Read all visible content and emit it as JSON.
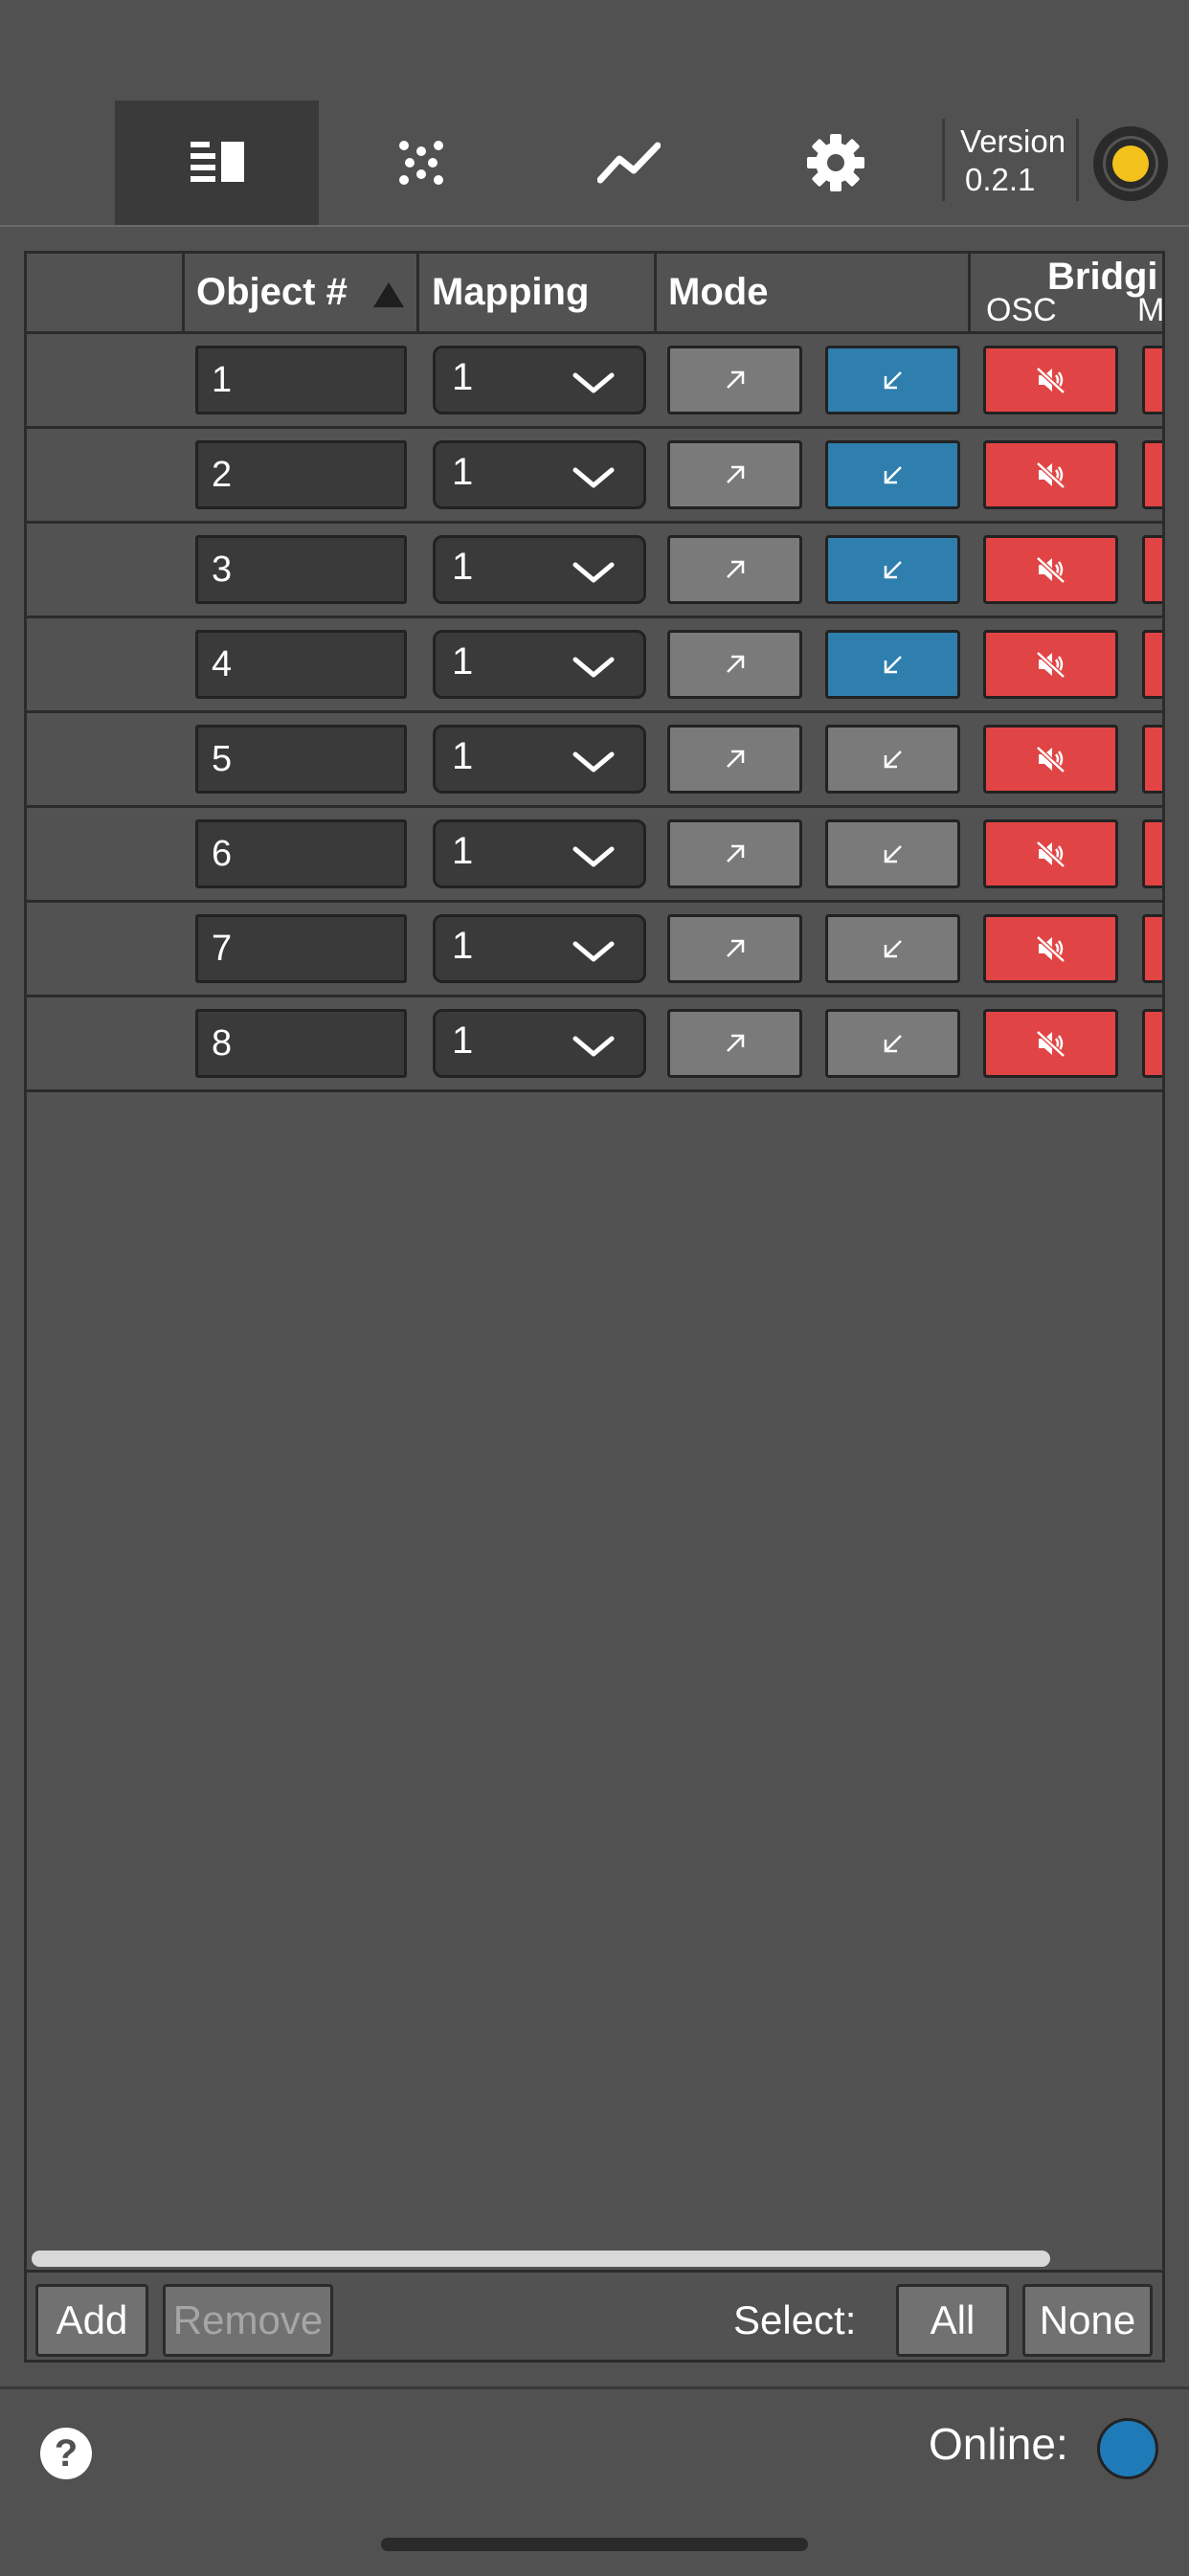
{
  "tabs": [
    {
      "icon": "list-icon",
      "active": true
    },
    {
      "icon": "dots-grid-icon",
      "active": false
    },
    {
      "icon": "graph-icon",
      "active": false
    },
    {
      "icon": "gear-icon",
      "active": false
    }
  ],
  "version": {
    "label": "Version",
    "number": "0.2.1"
  },
  "table": {
    "headers": {
      "object": "Object #",
      "mapping": "Mapping",
      "mode": "Mode",
      "bridging": "Bridgi",
      "osc": "OSC",
      "m": "M"
    },
    "rows": [
      {
        "object": "1",
        "mapping": "1",
        "mode_out": "inactive",
        "mode_in": "active",
        "osc": "muted"
      },
      {
        "object": "2",
        "mapping": "1",
        "mode_out": "inactive",
        "mode_in": "active",
        "osc": "muted"
      },
      {
        "object": "3",
        "mapping": "1",
        "mode_out": "inactive",
        "mode_in": "active",
        "osc": "muted"
      },
      {
        "object": "4",
        "mapping": "1",
        "mode_out": "inactive",
        "mode_in": "active",
        "osc": "muted"
      },
      {
        "object": "5",
        "mapping": "1",
        "mode_out": "inactive",
        "mode_in": "inactive",
        "osc": "muted"
      },
      {
        "object": "6",
        "mapping": "1",
        "mode_out": "inactive",
        "mode_in": "inactive",
        "osc": "muted"
      },
      {
        "object": "7",
        "mapping": "1",
        "mode_out": "inactive",
        "mode_in": "inactive",
        "osc": "muted"
      },
      {
        "object": "8",
        "mapping": "1",
        "mode_out": "inactive",
        "mode_in": "inactive",
        "osc": "muted"
      }
    ]
  },
  "footer": {
    "add": "Add",
    "remove": "Remove",
    "select_label": "Select:",
    "all": "All",
    "none": "None"
  },
  "status": {
    "help": "?",
    "online_label": "Online:"
  },
  "colors": {
    "accent_blue": "#2f7fae",
    "mute_red": "#e14444",
    "status_yellow": "#f4c21c",
    "online_blue": "#1f7bb8"
  }
}
